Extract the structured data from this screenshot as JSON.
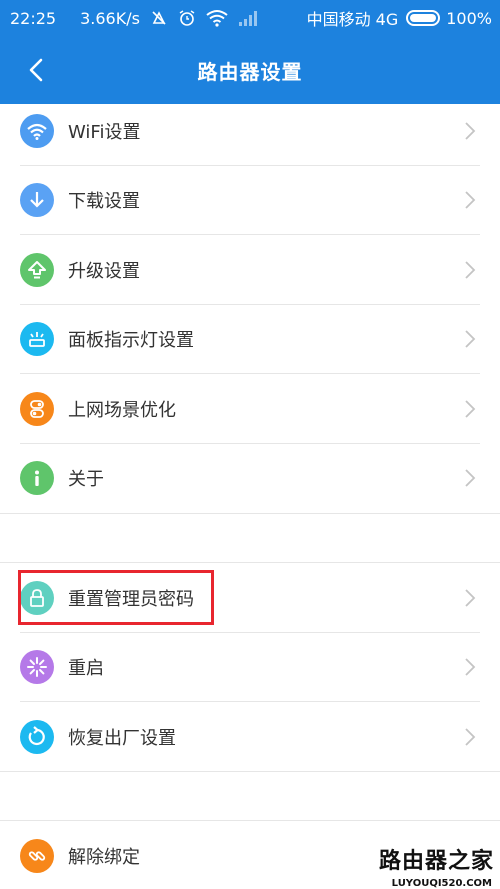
{
  "status_bar": {
    "time": "22:25",
    "speed": "3.66K/s",
    "carrier": "中国移动 4G",
    "battery": "100%"
  },
  "header": {
    "title": "路由器设置"
  },
  "colors": {
    "header_bg": "#1d82de",
    "highlight": "#e8262f"
  },
  "section1": [
    {
      "label": "WiFi设置",
      "icon": "wifi-icon",
      "color": "#4d9cf1"
    },
    {
      "label": "下载设置",
      "icon": "download-icon",
      "color": "#5aa2f4"
    },
    {
      "label": "升级设置",
      "icon": "upgrade-icon",
      "color": "#5fc56b"
    },
    {
      "label": "面板指示灯设置",
      "icon": "indicator-light-icon",
      "color": "#1cb9f0"
    },
    {
      "label": "上网场景优化",
      "icon": "scene-toggle-icon",
      "color": "#f7871a"
    },
    {
      "label": "关于",
      "icon": "info-icon",
      "color": "#5fc56b"
    }
  ],
  "section2": [
    {
      "label": "重置管理员密码",
      "icon": "lock-icon",
      "color": "#5fd0c0"
    },
    {
      "label": "重启",
      "icon": "restart-icon",
      "color": "#b579e8"
    },
    {
      "label": "恢复出厂设置",
      "icon": "factory-reset-icon",
      "color": "#1cb9f0"
    }
  ],
  "section3": [
    {
      "label": "解除绑定",
      "icon": "unbind-icon",
      "color": "#f7871a"
    }
  ],
  "watermark": {
    "main": "路由器之家",
    "sub": "LUYOUQI520.COM"
  }
}
